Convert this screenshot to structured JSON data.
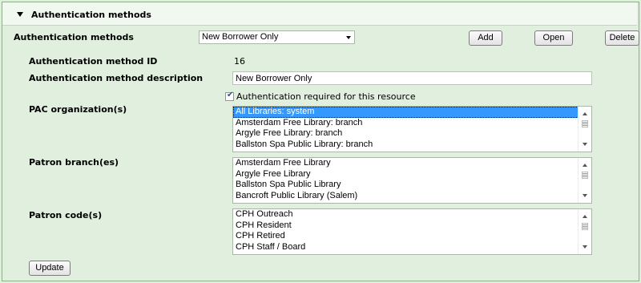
{
  "section": {
    "title": "Authentication methods"
  },
  "method_select": {
    "label": "Authentication methods",
    "value": "New Borrower Only"
  },
  "buttons": {
    "add": "Add",
    "open": "Open",
    "delete": "Delete",
    "update": "Update"
  },
  "method_id": {
    "label": "Authentication method ID",
    "value": "16"
  },
  "method_description": {
    "label": "Authentication method description",
    "value": "New Borrower Only"
  },
  "auth_required": {
    "label": "Authentication required for this resource",
    "checked": true
  },
  "pac_orgs": {
    "label": "PAC organization(s)",
    "options": [
      "All Libraries: system",
      "Amsterdam Free Library: branch",
      "Argyle Free Library: branch",
      "Ballston Spa Public Library: branch"
    ],
    "selected_index": 0
  },
  "patron_branches": {
    "label": "Patron branch(es)",
    "options": [
      "Amsterdam Free Library",
      "Argyle Free Library",
      "Ballston Spa Public Library",
      "Bancroft Public Library (Salem)"
    ]
  },
  "patron_codes": {
    "label": "Patron code(s)",
    "options": [
      "CPH Outreach",
      "CPH Resident",
      "CPH Retired",
      "CPH Staff / Board"
    ]
  }
}
